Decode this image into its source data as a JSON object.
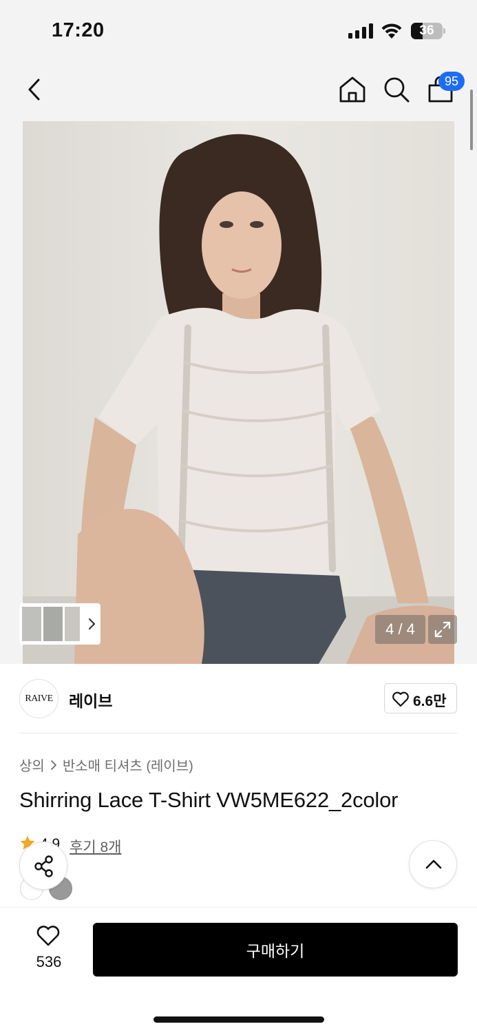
{
  "status_bar": {
    "time": "17:20",
    "battery": "36",
    "battery_level": 0.36,
    "icons": [
      "cellular-signal-icon",
      "wifi-icon",
      "battery-icon"
    ]
  },
  "header": {
    "icons": [
      "back-chevron-icon",
      "home-icon",
      "search-icon",
      "shopping-bag-icon"
    ],
    "bag_count": "95"
  },
  "gallery": {
    "counter": "4 / 4",
    "current_index": 4,
    "total": 4,
    "icons": [
      "thumbnail-chevron-icon",
      "expand-icon"
    ]
  },
  "brand": {
    "logo_text": "RAIVE",
    "name": "레이브",
    "likes": "6.6만"
  },
  "breadcrumb": {
    "items": [
      "상의",
      "반소매 티셔츠 (레이브)"
    ]
  },
  "product": {
    "title": "Shirring Lace T-Shirt VW5ME622_2color",
    "rating": "4.9",
    "reviews": "후기 8개",
    "color_swatches": [
      "#ffffff",
      "#999999"
    ]
  },
  "bottom_bar": {
    "wish_count": "536",
    "buy_label": "구매하기"
  },
  "colors": {
    "accent_badge": "#1d6df2",
    "star": "#f5a623",
    "buy_button": "#000000"
  }
}
